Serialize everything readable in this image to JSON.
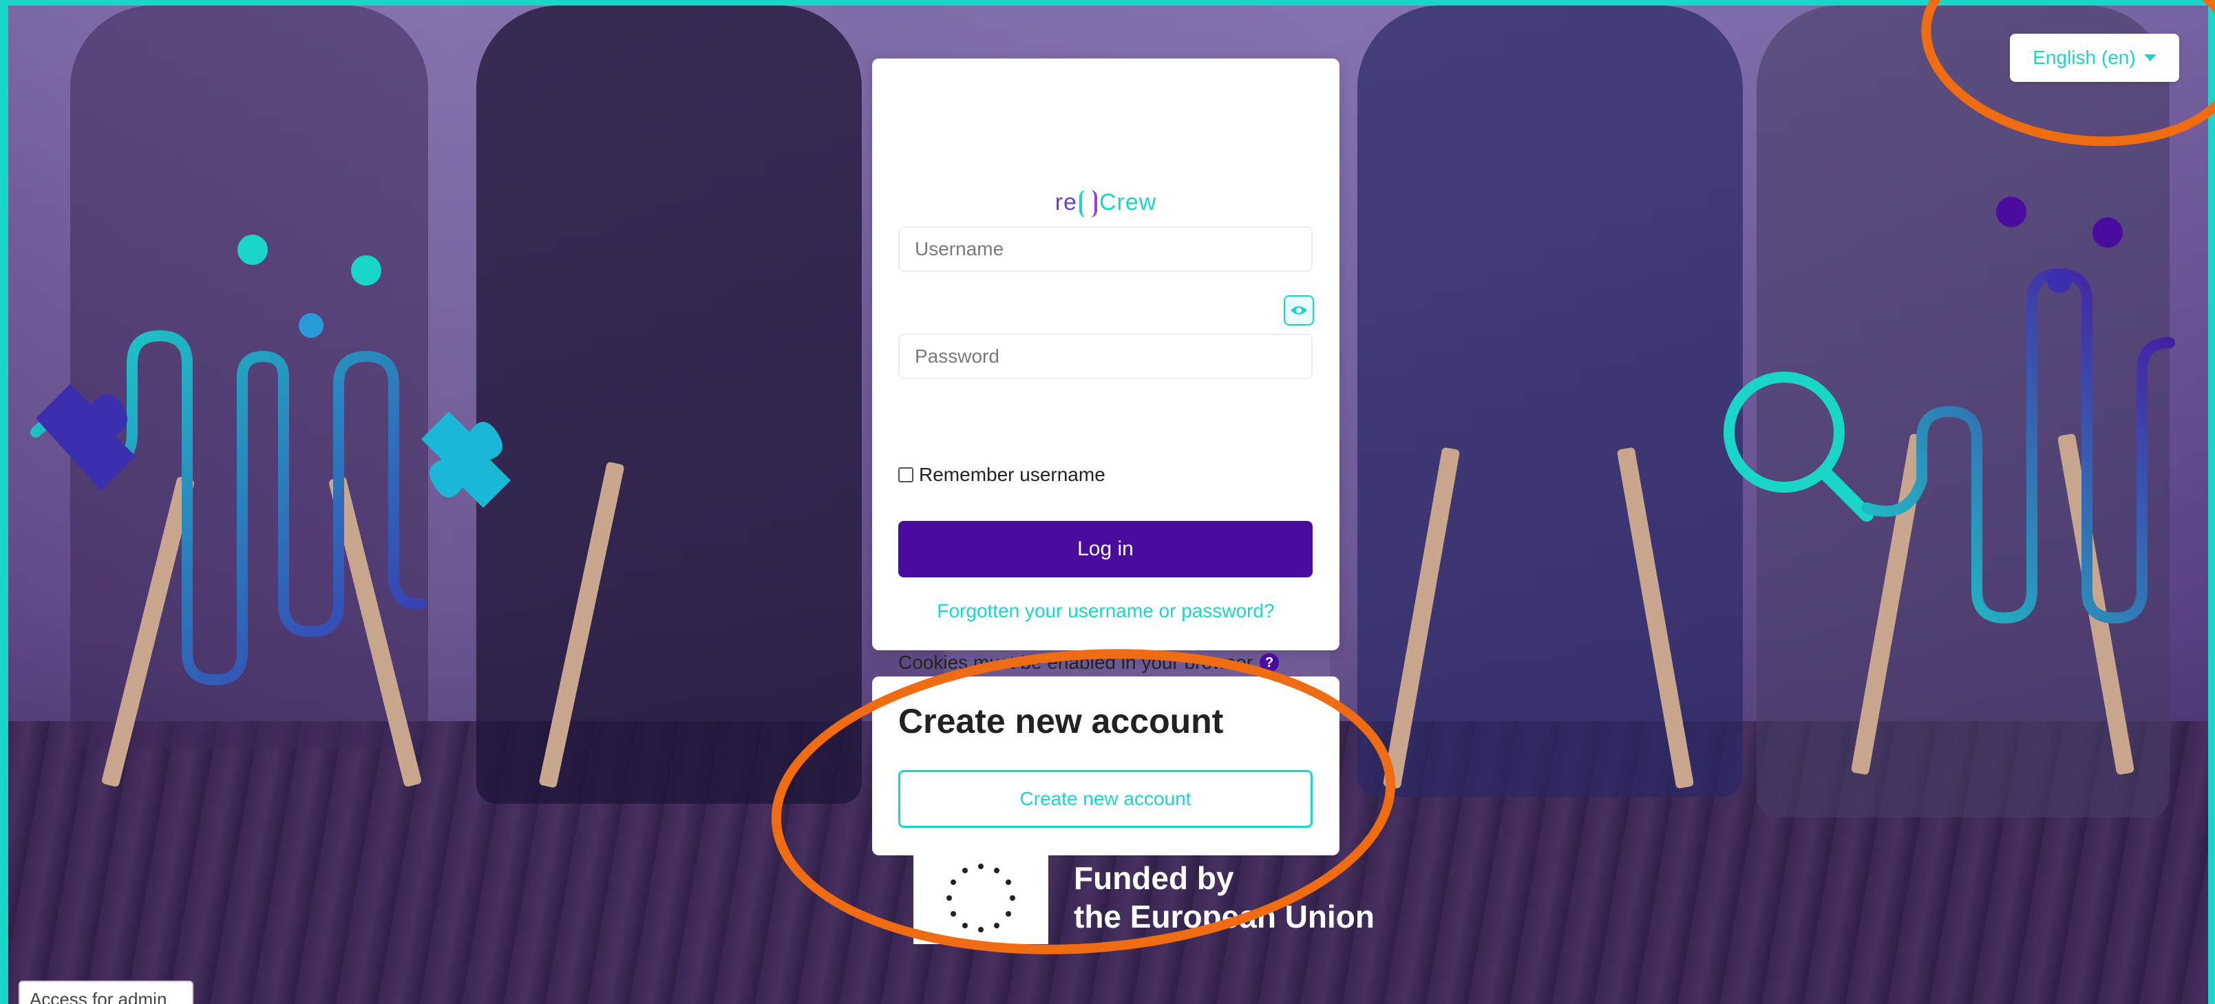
{
  "language_selector": {
    "label": "English (en)"
  },
  "login": {
    "logo_text_left": "re",
    "logo_text_right": "Crew",
    "username_placeholder": "Username",
    "password_placeholder": "Password",
    "remember_label": "Remember username",
    "login_button": "Log in",
    "forgot_link": "Forgotten your username or password?",
    "cookies_notice": "Cookies must be enabled in your browser"
  },
  "signup": {
    "heading": "Create new account",
    "button": "Create new account"
  },
  "funding": {
    "line1": "Funded by",
    "line2": "the European Union"
  },
  "admin": {
    "link": "Access for admin"
  },
  "colors": {
    "accent": "#1ad6c9",
    "primary": "#4a0c9e",
    "annotation": "#f06c12"
  }
}
